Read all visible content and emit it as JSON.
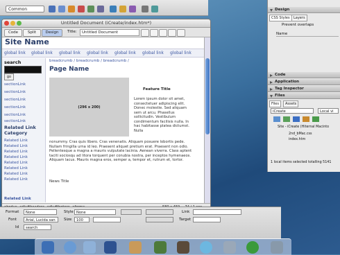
{
  "topbar": {
    "category": "Common"
  },
  "window": {
    "title": "Untitled Document (iCreate/index.htm*)"
  },
  "docbar": {
    "code": "Code",
    "split": "Split",
    "design": "Design",
    "title_label": "Title:",
    "title_value": "Untitled Document"
  },
  "page": {
    "site_name": "Site Name",
    "global_links": [
      "global link",
      "global link",
      "global link",
      "global link",
      "global link",
      "global link",
      "global link"
    ],
    "search_label": "search",
    "go": "go",
    "section_links": [
      "sectionLink",
      "sectionLink",
      "sectionLink",
      "sectionLink",
      "sectionLink",
      "sectionLink"
    ],
    "related_heading": "Related Link Category",
    "related_links": [
      "Related Link",
      "Related Link",
      "Related Link",
      "Related Link",
      "Related Link",
      "Related Link",
      "Related Link",
      "Related Link"
    ],
    "breadcrumb": "breadcrumb / breadcrumb / breadcrumb /",
    "page_name": "Page Name",
    "image_label": "(296 x 200)",
    "feature_title": "Feature Title",
    "para1": "Lorem ipsum dolor sit amet, consectetuer adipiscing elit. Donec molestie. Sed aliquam sem ut arcu. Phasellus sollicitudin. Vestibulum condimentum facilisis nulla. In hac habitasse platea dictumst. Nulla",
    "para2": "nonummy. Cras quis libero. Cras venenatis. Aliquam posuere lobortis pede. Nullam fringilla urna id leo. Praesent aliquet pretium erat. Praesent non odio. Pellentesque a magna a mauris vulputate lacinia. Aenean viverra. Class aptent taciti sociosqu ad litora torquent per conubia nostra, per inceptos hymenaeos. Aliquam lacus. Mauris magna eros, semper a, tempor et, rutrum et, tortor.",
    "news_title": "News Title",
    "related_extra": "Related Link"
  },
  "status": {
    "tags": "<body> <div#header> <div#footer> <form>",
    "size": "580 x 459 ⌄  74 / 1 sec"
  },
  "props": {
    "format_label": "Format",
    "format_value": "None",
    "style_label": "Style",
    "style_value": "None",
    "link_label": "Link",
    "font_label": "Font",
    "font_value": "Arial, Lucida san",
    "size_label": "Size",
    "size_value": "100",
    "target_label": "Target",
    "id_label": "Id",
    "id_value": "search"
  },
  "panels": {
    "design": "Design",
    "css_tab": "CSS Styles",
    "layers_tab": "Layers",
    "prevent_overlaps": "Prevent overlaps",
    "name_col": "Name",
    "code": "Code",
    "application": "Application",
    "tag_inspector": "Tag Inspector",
    "files": "Files",
    "files_tab": "Files",
    "assets_tab": "Assets",
    "site_select": "iCreate",
    "local_view": "Local vi",
    "tree_root": "Site - iCreate (Hiternal Macinto",
    "tree_file1": "2nd_bMac.css",
    "tree_file2": "index.htm",
    "files_status": "1 local items selected totalling 5141"
  }
}
